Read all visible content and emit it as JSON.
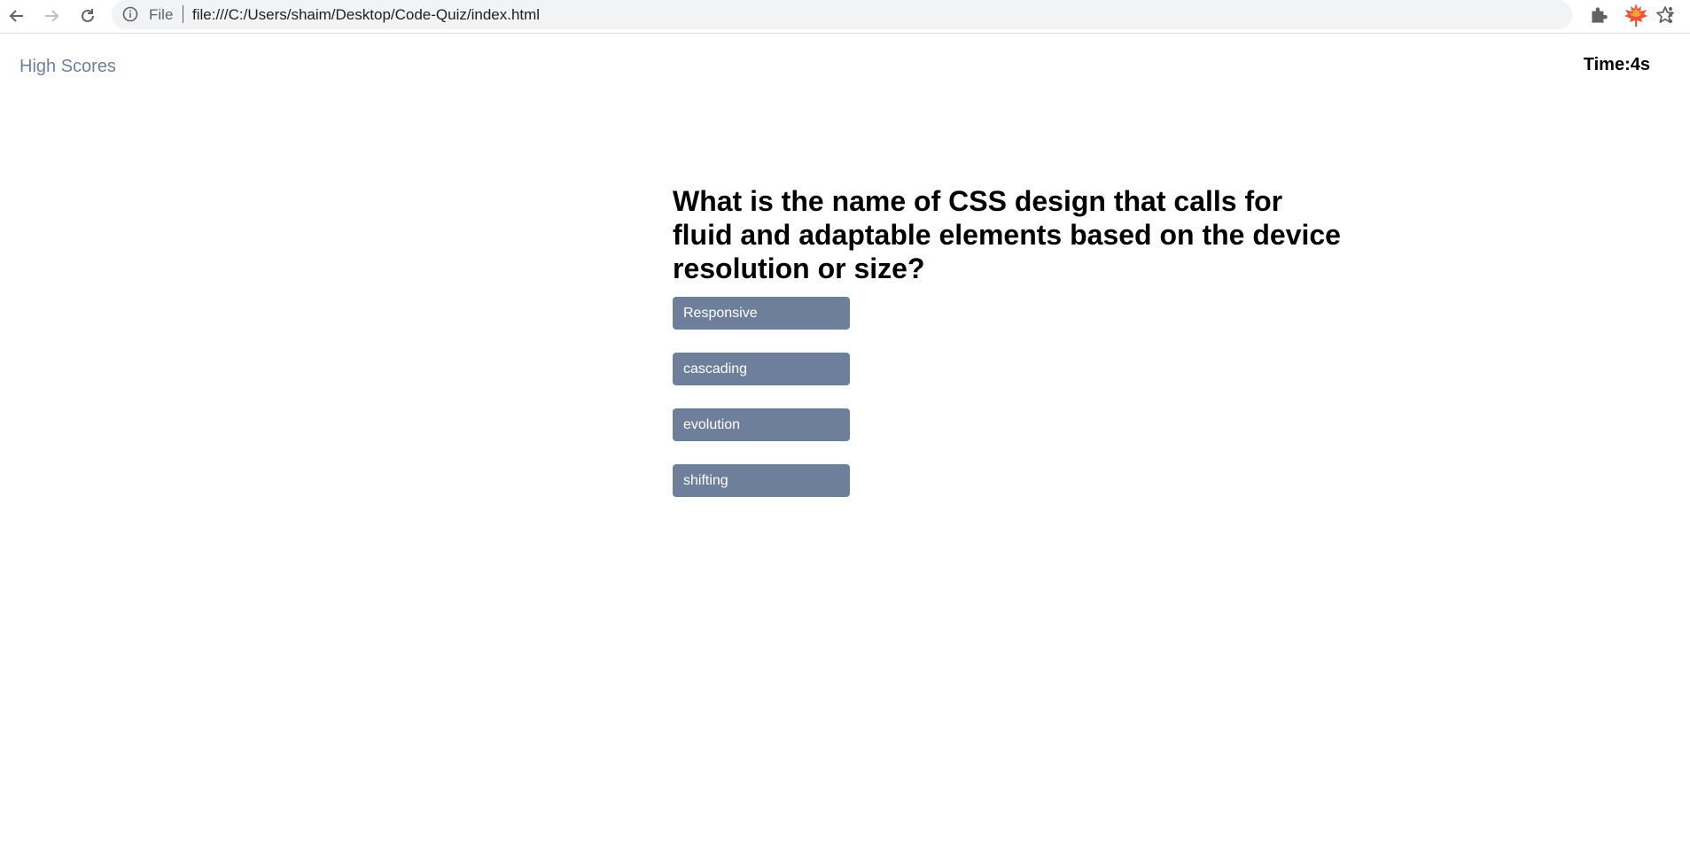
{
  "browser": {
    "scheme_label": "File",
    "url": "file:///C:/Users/shaim/Desktop/Code-Quiz/index.html",
    "icons": [
      "back-arrow-icon",
      "forward-arrow-icon",
      "reload-icon",
      "info-icon",
      "star-icon",
      "extensions-puzzle-icon",
      "maple-leaf-extension-icon",
      "kebab-menu-icon"
    ]
  },
  "header": {
    "high_scores_label": "High Scores",
    "timer_label": "Time:",
    "timer_value": "4s"
  },
  "quiz": {
    "question": "What is the name of CSS design that calls for fluid and adaptable elements based on the device resolution or size?",
    "choices": [
      {
        "label": "Responsive"
      },
      {
        "label": "cascading"
      },
      {
        "label": "evolution"
      },
      {
        "label": "shifting"
      }
    ]
  },
  "colors": {
    "accent": "#6d7f9b",
    "button_text": "#ffffff",
    "omnibox_bg": "#f1f3f4"
  }
}
